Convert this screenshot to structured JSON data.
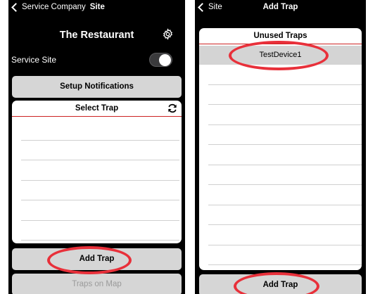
{
  "left_screen": {
    "nav": {
      "back_label": "Service Company",
      "title": "Site"
    },
    "header_title": "The Restaurant",
    "service_site": {
      "label": "Service Site",
      "toggle_on": false
    },
    "setup_notifications_label": "Setup Notifications",
    "select_trap": {
      "header": "Select Trap",
      "rows": 6
    },
    "add_trap_label": "Add Trap",
    "traps_on_map_label": "Traps on Map"
  },
  "right_screen": {
    "nav": {
      "back_label": "Site",
      "title": "Add Trap"
    },
    "unused_traps": {
      "header": "Unused Traps",
      "items": [
        "TestDevice1"
      ]
    },
    "add_trap_label": "Add Trap"
  },
  "colors": {
    "highlight": "#e8303a",
    "header_underline": "#cc2222",
    "button": "#d6d6d6"
  },
  "icons": [
    "chevron-left-icon",
    "gear-icon",
    "refresh-icon"
  ]
}
